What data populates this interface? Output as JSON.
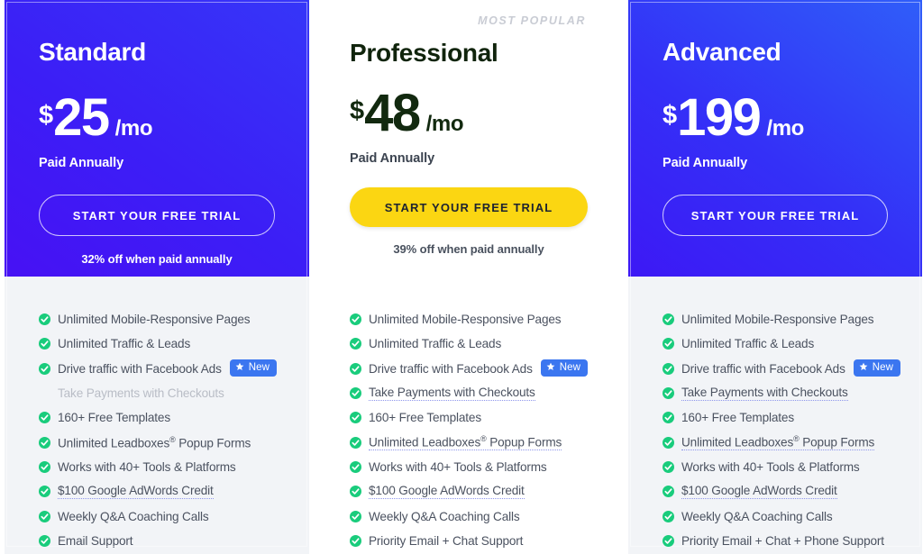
{
  "colors": {
    "standard_bg_start": "#3636f8",
    "standard_bg_end": "#4711f4",
    "advanced_bg_start": "#2f5ef9",
    "advanced_bg_end": "#3d18f5",
    "pro_cta_yellow": "#fbd612",
    "pro_price_green": "#12290f",
    "check_green": "#19cc7c",
    "badge_blue": "#3b76f0",
    "panel_grey": "#f2f4f7"
  },
  "plans": [
    {
      "name": "Standard",
      "currency": "$",
      "amount": "25",
      "per": "/mo",
      "billing_note": "Paid Annually",
      "cta_label": "START YOUR FREE TRIAL",
      "discount": "32% off when paid annually",
      "most_popular_label": "",
      "features": [
        {
          "text": "Unlimited Mobile-Responsive Pages",
          "included": true,
          "dotted": false,
          "badge": ""
        },
        {
          "text": "Unlimited Traffic & Leads",
          "included": true,
          "dotted": false,
          "badge": ""
        },
        {
          "text": "Drive traffic with Facebook Ads",
          "included": true,
          "dotted": false,
          "badge": "New"
        },
        {
          "text": "Take Payments with Checkouts",
          "included": false,
          "dotted": false,
          "badge": ""
        },
        {
          "text": "160+ Free Templates",
          "included": true,
          "dotted": false,
          "badge": ""
        },
        {
          "text": "Unlimited Leadboxes® Popup Forms",
          "included": true,
          "dotted": false,
          "badge": ""
        },
        {
          "text": "Works with 40+ Tools & Platforms",
          "included": true,
          "dotted": false,
          "badge": ""
        },
        {
          "text": "$100 Google AdWords Credit",
          "included": true,
          "dotted": true,
          "badge": ""
        },
        {
          "text": "Weekly Q&A Coaching Calls",
          "included": true,
          "dotted": false,
          "badge": ""
        },
        {
          "text": "Email Support",
          "included": true,
          "dotted": false,
          "badge": ""
        }
      ]
    },
    {
      "name": "Professional",
      "currency": "$",
      "amount": "48",
      "per": "/mo",
      "billing_note": "Paid Annually",
      "cta_label": "START YOUR FREE TRIAL",
      "discount": "39% off when paid annually",
      "most_popular_label": "MOST POPULAR",
      "features": [
        {
          "text": "Unlimited Mobile-Responsive Pages",
          "included": true,
          "dotted": false,
          "badge": ""
        },
        {
          "text": "Unlimited Traffic & Leads",
          "included": true,
          "dotted": false,
          "badge": ""
        },
        {
          "text": "Drive traffic with Facebook Ads",
          "included": true,
          "dotted": false,
          "badge": "New"
        },
        {
          "text": "Take Payments with Checkouts",
          "included": true,
          "dotted": true,
          "badge": ""
        },
        {
          "text": "160+ Free Templates",
          "included": true,
          "dotted": false,
          "badge": ""
        },
        {
          "text": "Unlimited Leadboxes® Popup Forms",
          "included": true,
          "dotted": true,
          "badge": ""
        },
        {
          "text": "Works with 40+ Tools & Platforms",
          "included": true,
          "dotted": false,
          "badge": ""
        },
        {
          "text": "$100 Google AdWords Credit",
          "included": true,
          "dotted": true,
          "badge": ""
        },
        {
          "text": "Weekly Q&A Coaching Calls",
          "included": true,
          "dotted": false,
          "badge": ""
        },
        {
          "text": "Priority Email + Chat Support",
          "included": true,
          "dotted": false,
          "badge": ""
        }
      ]
    },
    {
      "name": "Advanced",
      "currency": "$",
      "amount": "199",
      "per": "/mo",
      "billing_note": "Paid Annually",
      "cta_label": "START YOUR FREE TRIAL",
      "discount": "",
      "most_popular_label": "",
      "features": [
        {
          "text": "Unlimited Mobile-Responsive Pages",
          "included": true,
          "dotted": false,
          "badge": ""
        },
        {
          "text": "Unlimited Traffic & Leads",
          "included": true,
          "dotted": false,
          "badge": ""
        },
        {
          "text": "Drive traffic with Facebook Ads",
          "included": true,
          "dotted": false,
          "badge": "New"
        },
        {
          "text": "Take Payments with Checkouts",
          "included": true,
          "dotted": true,
          "badge": ""
        },
        {
          "text": "160+ Free Templates",
          "included": true,
          "dotted": false,
          "badge": ""
        },
        {
          "text": "Unlimited Leadboxes® Popup Forms",
          "included": true,
          "dotted": true,
          "badge": ""
        },
        {
          "text": "Works with 40+ Tools & Platforms",
          "included": true,
          "dotted": false,
          "badge": ""
        },
        {
          "text": "$100 Google AdWords Credit",
          "included": true,
          "dotted": true,
          "badge": ""
        },
        {
          "text": "Weekly Q&A Coaching Calls",
          "included": true,
          "dotted": false,
          "badge": ""
        },
        {
          "text": "Priority Email + Chat + Phone Support",
          "included": true,
          "dotted": false,
          "badge": ""
        }
      ]
    }
  ]
}
